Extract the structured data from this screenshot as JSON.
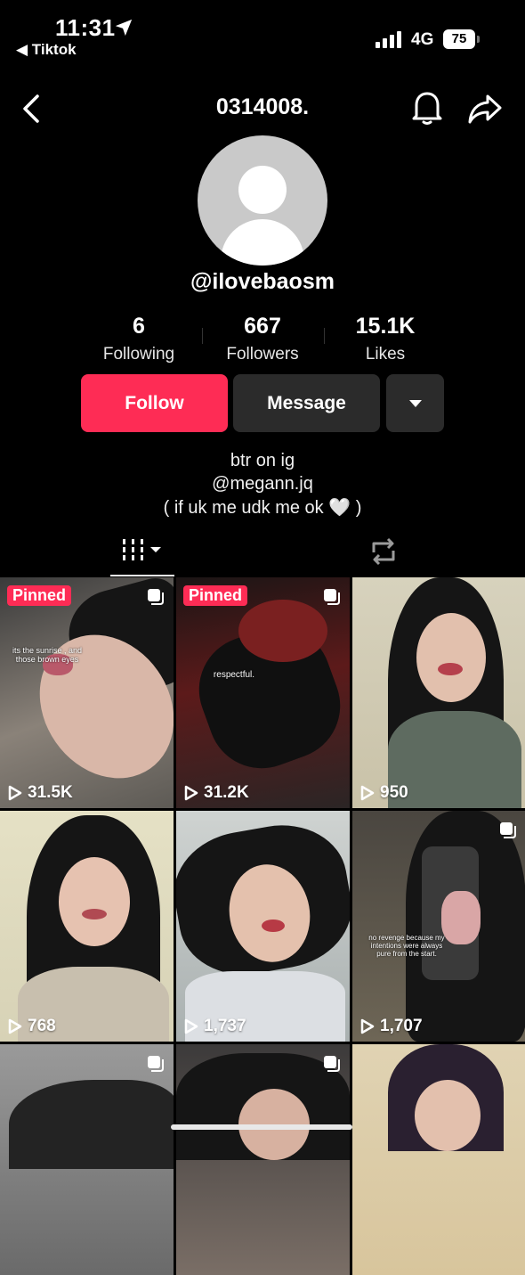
{
  "status_bar": {
    "time": "11:31",
    "back_app": "◀ Tiktok",
    "network": "4G",
    "battery": "75"
  },
  "nav": {
    "title": "0314008."
  },
  "profile": {
    "handle": "@ilovebaosm",
    "stats": [
      {
        "value": "6",
        "label": "Following"
      },
      {
        "value": "667",
        "label": "Followers"
      },
      {
        "value": "15.1K",
        "label": "Likes"
      }
    ],
    "follow_label": "Follow",
    "message_label": "Message",
    "bio": [
      "btr on ig",
      "@megann.jq",
      "( if uk me udk me ok 🤍 )"
    ],
    "accent_color": "#fe2c55"
  },
  "tabs": [
    {
      "icon": "videos-grid-icon"
    },
    {
      "icon": "repost-icon"
    }
  ],
  "videos": [
    {
      "views": "31.5K",
      "pinned_label": "Pinned",
      "caption": "its the sunrise , and those brown eyes",
      "multi": true
    },
    {
      "views": "31.2K",
      "pinned_label": "Pinned",
      "caption": "respectful.",
      "multi": true
    },
    {
      "views": "950",
      "multi": false
    },
    {
      "views": "768",
      "multi": false
    },
    {
      "views": "1,737",
      "multi": false
    },
    {
      "views": "1,707",
      "caption": "no revenge because my intentions were always pure from the start.",
      "multi": true
    },
    {
      "views": "",
      "multi": true
    },
    {
      "views": "",
      "multi": true
    },
    {
      "views": "",
      "multi": false
    }
  ]
}
